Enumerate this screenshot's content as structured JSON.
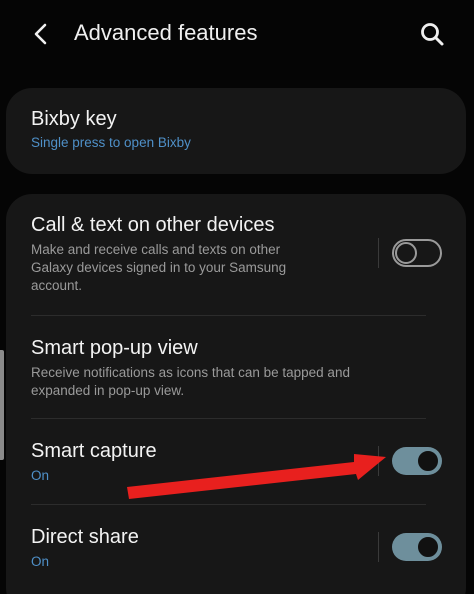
{
  "header": {
    "title": "Advanced features",
    "back_icon": "chevron-left-icon",
    "search_icon": "search-icon"
  },
  "bixby_key": {
    "title": "Bixby key",
    "subtitle": "Single press to open Bixby"
  },
  "settings": [
    {
      "title": "Call & text on other devices",
      "subtitle_lines": [
        "Make and receive calls and texts on other",
        "Galaxy devices signed in to your Samsung",
        "account."
      ],
      "toggle_on": false
    },
    {
      "title": "Smart pop-up view",
      "subtitle_lines": [
        "Receive notifications as icons that can be tapped and",
        "expanded in pop-up view."
      ]
    },
    {
      "title": "Smart capture",
      "status": "On",
      "toggle_on": true
    },
    {
      "title": "Direct share",
      "status": "On",
      "toggle_on": true
    }
  ],
  "colors": {
    "background": "#050505",
    "card": "#171717",
    "accent_blue": "#4f90c8",
    "toggle_on": "#6e8f9c",
    "annotation_arrow": "#e8201e"
  }
}
